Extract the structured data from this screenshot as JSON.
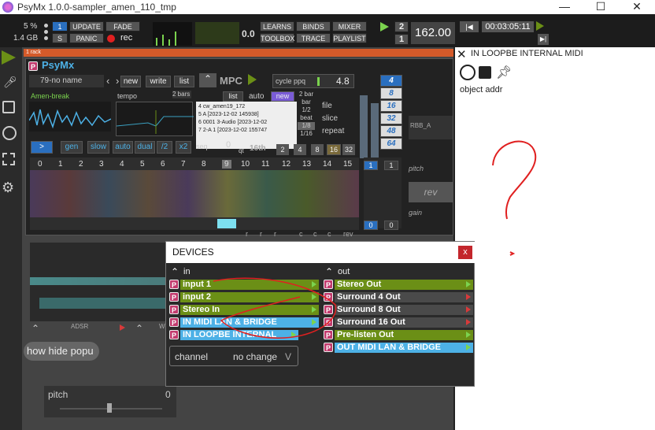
{
  "window": {
    "title": "PsyMx 1.0.0-sampler_amen_110_tmp",
    "min": "—",
    "max": "☐",
    "close": "✕"
  },
  "top": {
    "cpu": "5 %",
    "mem": "1.4 GB",
    "one": "1",
    "update": "UPDATE",
    "fade": "FADE",
    "s": "S",
    "panic": "PANIC",
    "rec": "rec",
    "level": "0.0",
    "learns": "LEARNS",
    "binds": "BINDS",
    "mixer": "MIXER",
    "toolbox": "TOOLBOX",
    "trace": "TRACE",
    "playlist": "PLAYLIST",
    "beats_num": "2",
    "beats_den": "1",
    "bpm": "162.00",
    "time": "00:03:05:11"
  },
  "rack": {
    "label": "1 rack"
  },
  "plugin": {
    "name": "PsyMx",
    "preset": "79-no name",
    "new": "new",
    "write": "write",
    "list": "list",
    "mpc": "MPC",
    "cycle_label": "cycle ppq",
    "cycle_val": "4.8",
    "sample": "Amen-break",
    "tempo": "tempo",
    "bars": "2 bars",
    "list2": "list",
    "auto": "auto",
    "new2": "new",
    "files": [
      {
        "n": "4",
        "name": "cw_amen19_172"
      },
      {
        "n": "5",
        "name": "A [2023-12-02 145938]"
      },
      {
        "n": "6",
        "name": "0001 3-Audio [2023-12-02"
      },
      {
        "n": "7",
        "name": "2-A 1 [2023-12-02 155747"
      }
    ],
    "bar_opts": [
      "2 bar",
      "bar",
      "1/2",
      "beat",
      "1/8",
      "1/16"
    ],
    "file": "file",
    "slice": "slice",
    "repeat": "repeat",
    "modes": [
      ">",
      "gen",
      "slow",
      "auto",
      "dual",
      "/2",
      "x2"
    ],
    "seq": "seq",
    "seq_val": "0",
    "qt": "qt",
    "q16": "16th",
    "qbtns": [
      "2",
      "4",
      "8",
      "16",
      "32"
    ],
    "steps": [
      "0",
      "1",
      "2",
      "3",
      "4",
      "5",
      "6",
      "7",
      "8",
      "9",
      "10",
      "11",
      "12",
      "13",
      "14",
      "15"
    ],
    "divs": [
      "4",
      "8",
      "16",
      "32",
      "48",
      "64"
    ],
    "col_vals": [
      "1",
      "1",
      "0",
      "0"
    ],
    "rbb": "RBB_A",
    "pitch": "pitch",
    "rev": "rev",
    "gain": "gain",
    "letters": [
      "r",
      "r",
      "r",
      "c",
      "c",
      "c",
      "rev"
    ],
    "adsr": "ADSR",
    "w": "W",
    "showhide": "how hide popu",
    "pitch2": "pitch",
    "pitch2_val": "0"
  },
  "right": {
    "title": "IN LOOPBE INTERNAL MIDI",
    "obj": "object addr"
  },
  "devices": {
    "title": "DEVICES",
    "close": "x",
    "in_label": "in",
    "out_label": "out",
    "inputs": [
      {
        "name": "input 1",
        "style": "green"
      },
      {
        "name": "input 2",
        "style": "green"
      },
      {
        "name": "Stereo In",
        "style": "green"
      },
      {
        "name": "IN MIDI LAN & BRIDGE",
        "style": "cyan"
      },
      {
        "name": "IN LOOPBE INTERNAL",
        "style": "cyan"
      }
    ],
    "outputs": [
      {
        "name": "Stereo Out",
        "style": "green"
      },
      {
        "name": "Surround 4 Out",
        "style": "dark"
      },
      {
        "name": "Surround 8 Out",
        "style": "dark"
      },
      {
        "name": "Surround 16 Out",
        "style": "dark"
      },
      {
        "name": "Pre-listen Out",
        "style": "green"
      },
      {
        "name": "OUT MIDI LAN & BRIDGE",
        "style": "cyan"
      }
    ],
    "p": "P",
    "channel_label": "channel",
    "channel_val": "no change",
    "chevron": "V"
  },
  "colors": {
    "green": "#6b8f16",
    "cyan": "#4db1e6",
    "accent": "#2a6fbf",
    "rec": "#e02020"
  }
}
